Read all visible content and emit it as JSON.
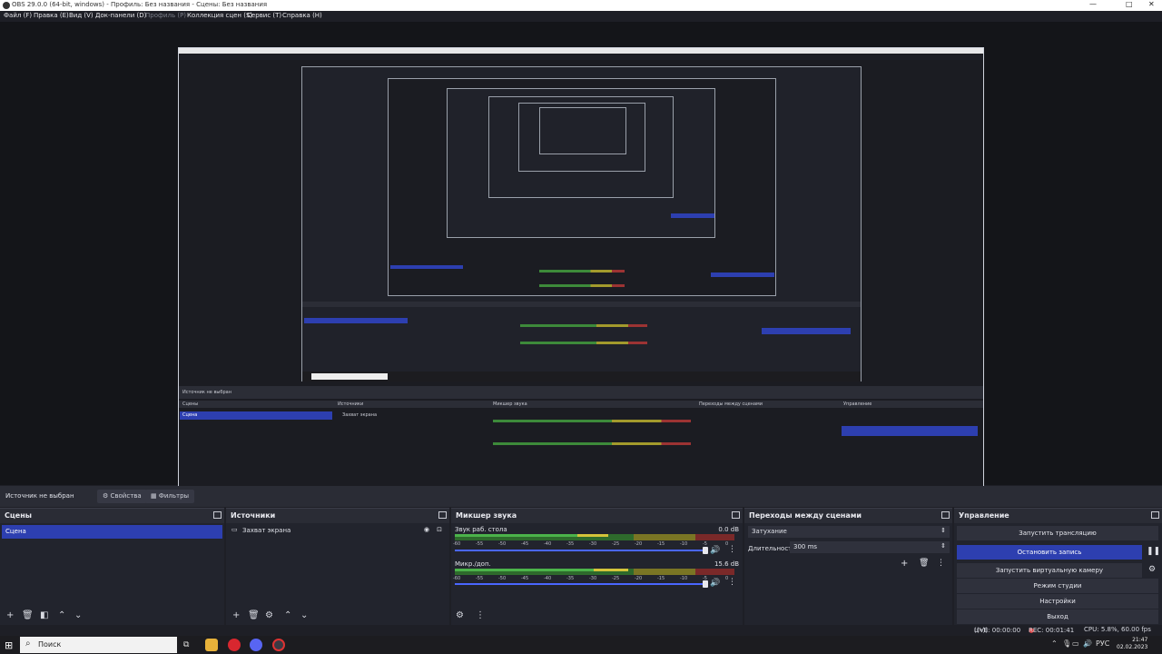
{
  "window": {
    "title": "OBS 29.0.0 (64-bit, windows) - Профиль: Без названия - Сцены: Без названия",
    "minimize": "—",
    "maximize": "□",
    "close": "✕"
  },
  "menu": {
    "file": "Файл (F)",
    "edit": "Правка (E)",
    "view": "Вид (V)",
    "docks": "Док-панели (D)",
    "profile": "Профиль (P)",
    "collection": "Коллекция сцен (S)",
    "tools": "Сервис (T)",
    "help": "Справка (H)"
  },
  "source_bar": {
    "label": "Источник не выбран",
    "properties": "Свойства",
    "filters": "Фильтры"
  },
  "scenes": {
    "title": "Сцены",
    "items": [
      "Сцена"
    ]
  },
  "sources": {
    "title": "Источники",
    "items": [
      "Захват экрана"
    ]
  },
  "mixer": {
    "title": "Микшер звука",
    "channels": [
      {
        "name": "Звук раб. стола",
        "db": "0.0 dB",
        "level": 0.55
      },
      {
        "name": "Микр./доп.",
        "db": "15.6 dB",
        "level": 0.62
      }
    ],
    "ticks": [
      "-60",
      "-55",
      "-50",
      "-45",
      "-40",
      "-35",
      "-30",
      "-25",
      "-20",
      "-15",
      "-10",
      "-5",
      "0"
    ]
  },
  "transitions": {
    "title": "Переходы между сценами",
    "selected": "Затухание",
    "duration_label": "Длительность",
    "duration_value": "300 ms"
  },
  "controls": {
    "title": "Управление",
    "start_stream": "Запустить трансляцию",
    "stop_recording": "Остановить запись",
    "start_virtualcam": "Запустить виртуальную камеру",
    "studio_mode": "Режим студии",
    "settings": "Настройки",
    "exit": "Выход"
  },
  "status": {
    "live": "LIVE: 00:00:00",
    "rec": "REC: 00:01:41",
    "cpu": "CPU: 5.8%, 60.00 fps"
  },
  "taskbar": {
    "search_placeholder": "Поиск",
    "lang": "РУС",
    "time": "21:47",
    "date": "02.02.2023"
  },
  "colors": {
    "accent": "#2d3fb0",
    "background": "#1e1f26",
    "panel": "#22242d"
  }
}
